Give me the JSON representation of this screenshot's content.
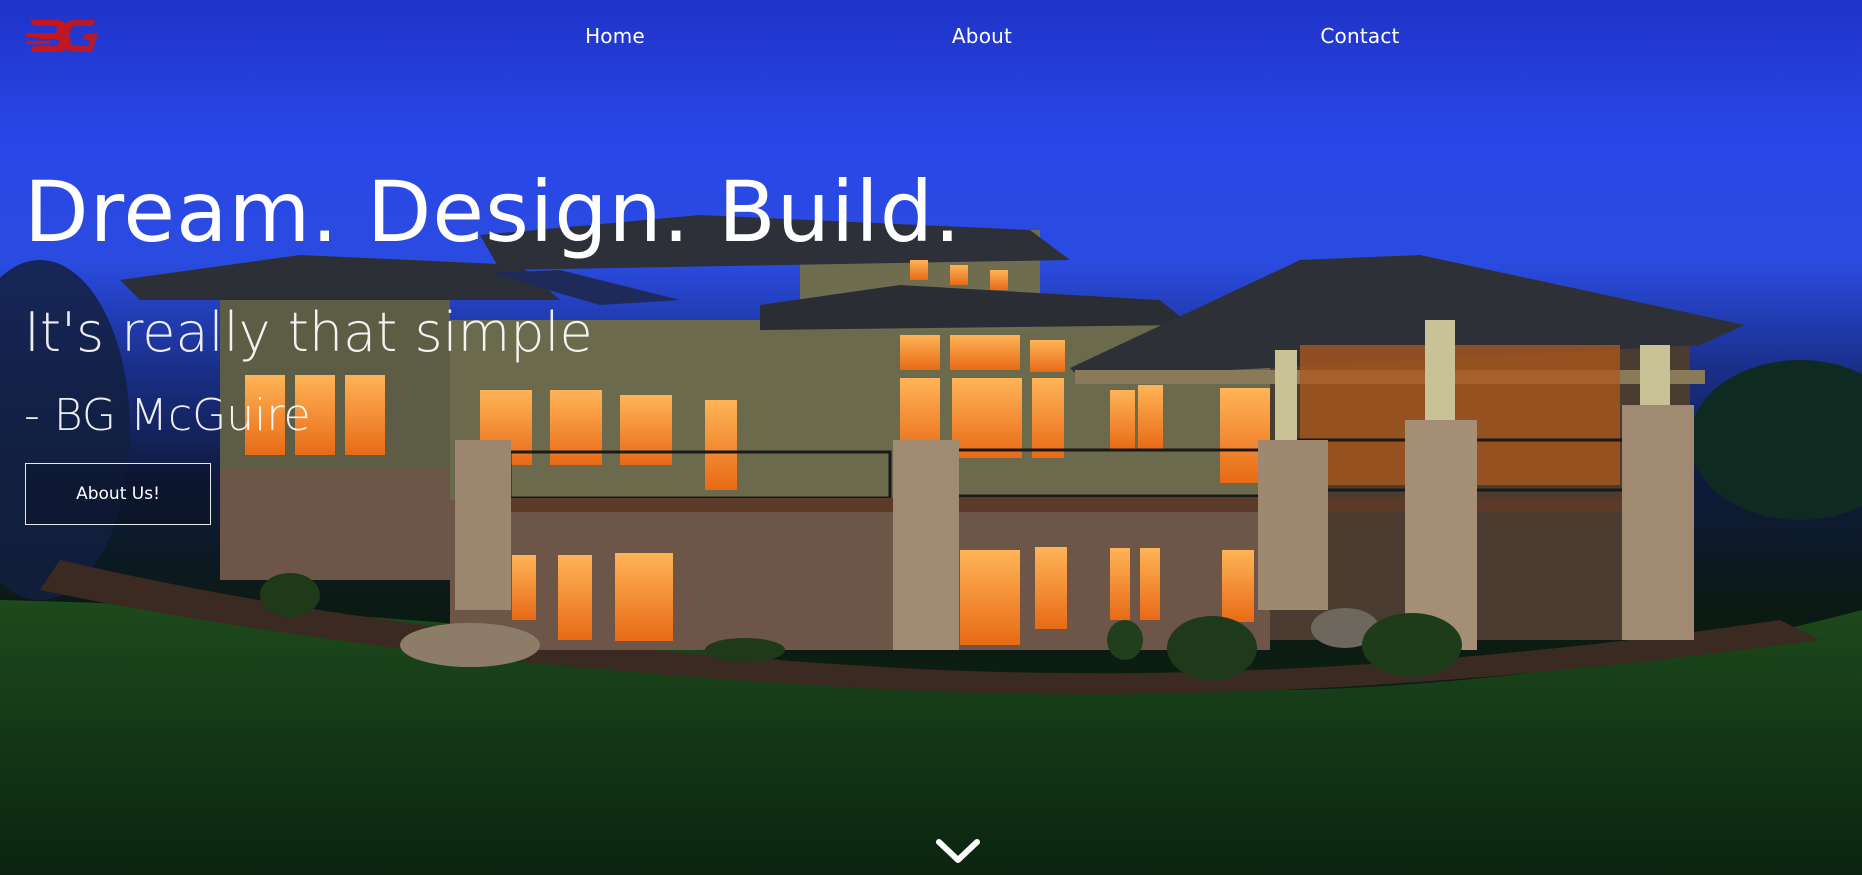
{
  "brand": {
    "logo_icon": "bg-monogram-logo",
    "logo_color": "#c4161c"
  },
  "nav": {
    "items": [
      {
        "label": "Home"
      },
      {
        "label": "About"
      },
      {
        "label": "Contact"
      }
    ]
  },
  "hero": {
    "headline": "Dream. Design. Build.",
    "tagline": "It's really that simple",
    "author": "- BG McGuire",
    "cta_label": "About Us!",
    "scroll_icon": "chevron-down-icon"
  },
  "colors": {
    "sky": "#2947e8",
    "text": "#ffffff",
    "window_glow": "#f08a2a",
    "lawn": "#123814"
  }
}
